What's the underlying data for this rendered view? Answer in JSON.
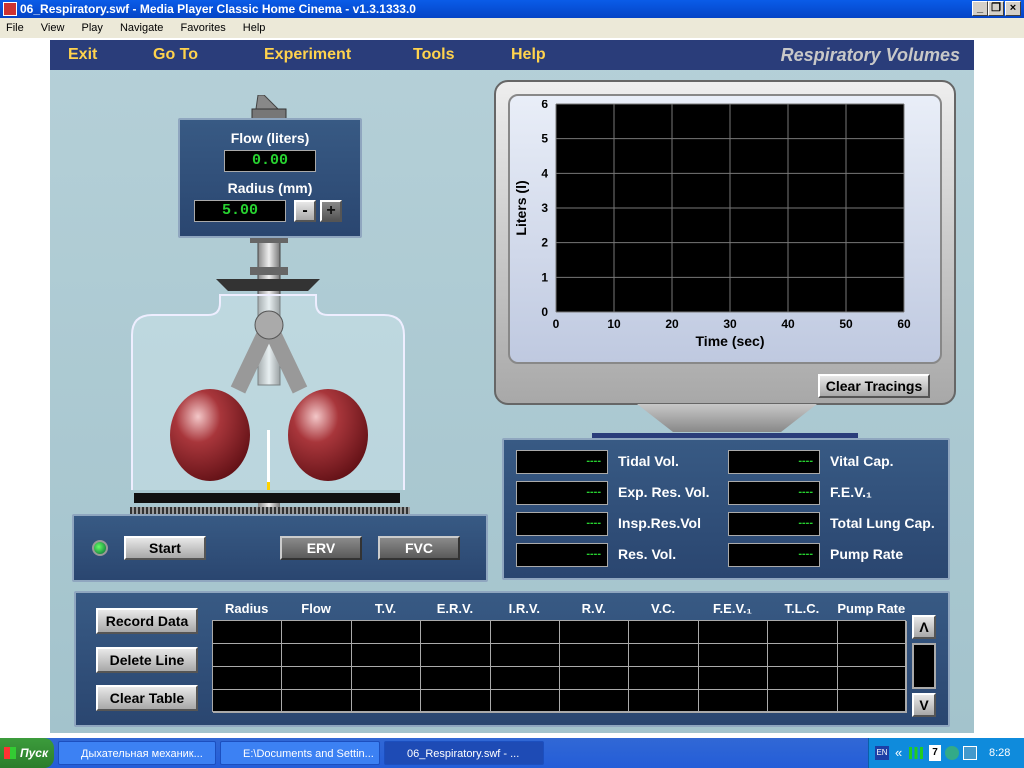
{
  "window": {
    "title": "06_Respiratory.swf - Media Player Classic Home Cinema - v1.3.1333.0",
    "min_glyph": "_",
    "max_glyph": "❐",
    "close_glyph": "×"
  },
  "player_menu": [
    "File",
    "View",
    "Play",
    "Navigate",
    "Favorites",
    "Help"
  ],
  "app_menu": {
    "items": [
      "Exit",
      "Go To",
      "Experiment",
      "Tools",
      "Help"
    ],
    "title": "Respiratory Volumes"
  },
  "flow_widget": {
    "flow_label": "Flow (liters)",
    "flow_value": "0.00",
    "radius_label": "Radius (mm)",
    "radius_value": "5.00",
    "minus": "-",
    "plus": "+"
  },
  "chart_data": {
    "type": "line",
    "title": "",
    "xlabel": "Time (sec)",
    "ylabel": "Liters (l)",
    "xlim": [
      0,
      60
    ],
    "ylim": [
      0,
      6
    ],
    "x_ticks": [
      0,
      10,
      20,
      30,
      40,
      50,
      60
    ],
    "y_ticks": [
      0,
      1,
      2,
      3,
      4,
      5,
      6
    ],
    "series": [],
    "grid": true
  },
  "monitor": {
    "clear_button": "Clear Tracings"
  },
  "controls": {
    "start": "Start",
    "erv": "ERV",
    "fvc": "FVC"
  },
  "readouts": {
    "left": [
      {
        "label": "Tidal Vol.",
        "value": "----"
      },
      {
        "label": "Exp. Res. Vol.",
        "value": "----"
      },
      {
        "label": "Insp.Res.Vol",
        "value": "----"
      },
      {
        "label": "Res. Vol.",
        "value": "----"
      }
    ],
    "right": [
      {
        "label": "Vital Cap.",
        "value": "----"
      },
      {
        "label": "F.E.V.₁",
        "value": "----"
      },
      {
        "label": "Total Lung Cap.",
        "value": "----"
      },
      {
        "label": "Pump Rate",
        "value": "----"
      }
    ]
  },
  "table": {
    "record": "Record Data",
    "delete": "Delete Line",
    "clear": "Clear Table",
    "headers": [
      "Radius",
      "Flow",
      "T.V.",
      "E.R.V.",
      "I.R.V.",
      "R.V.",
      "V.C.",
      "F.E.V.₁",
      "T.L.C.",
      "Pump Rate"
    ],
    "scroll_up": "Λ",
    "scroll_down": "V"
  },
  "taskbar": {
    "start_label": "Пуск",
    "tasks": [
      "Дыхательная механик...",
      "E:\\Documents and Settin...",
      "06_Respiratory.swf - ..."
    ],
    "lang": "EN",
    "badge": "7",
    "chevron": "«",
    "clock": "8:28"
  },
  "colors": {
    "app_menu_bg": "#2a3d7a",
    "app_menu_text": "#ffd34d",
    "lcd_text": "#27d230",
    "balloon": "#8b1a1e"
  }
}
